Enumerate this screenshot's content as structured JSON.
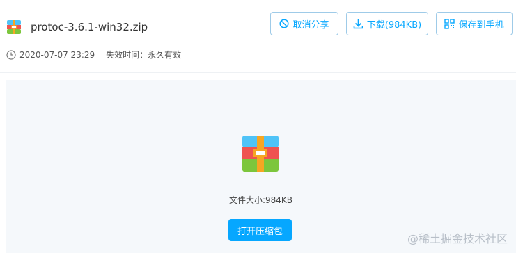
{
  "file": {
    "name": "protoc-3.6.1-win32.zip",
    "date": "2020-07-07 23:29",
    "expiry": "失效时间：永久有效",
    "size_label": "文件大小:984KB"
  },
  "actions": {
    "cancel_share": "取消分享",
    "download": "下载(984KB)",
    "save_to_phone": "保存到手机",
    "open_archive": "打开压缩包"
  },
  "watermark": "@稀土掘金技术社区",
  "colors": {
    "accent": "#06a7ff",
    "button_border": "#9fcbe8",
    "preview_bg": "#f5f8fb",
    "archive_top": "#4fc3f7",
    "archive_mid": "#ef5350",
    "archive_bottom": "#7cc63c",
    "archive_band": "#f6a623"
  },
  "icons": [
    "archive-icon",
    "clock-icon",
    "cancel-icon",
    "download-icon",
    "qrcode-icon"
  ]
}
